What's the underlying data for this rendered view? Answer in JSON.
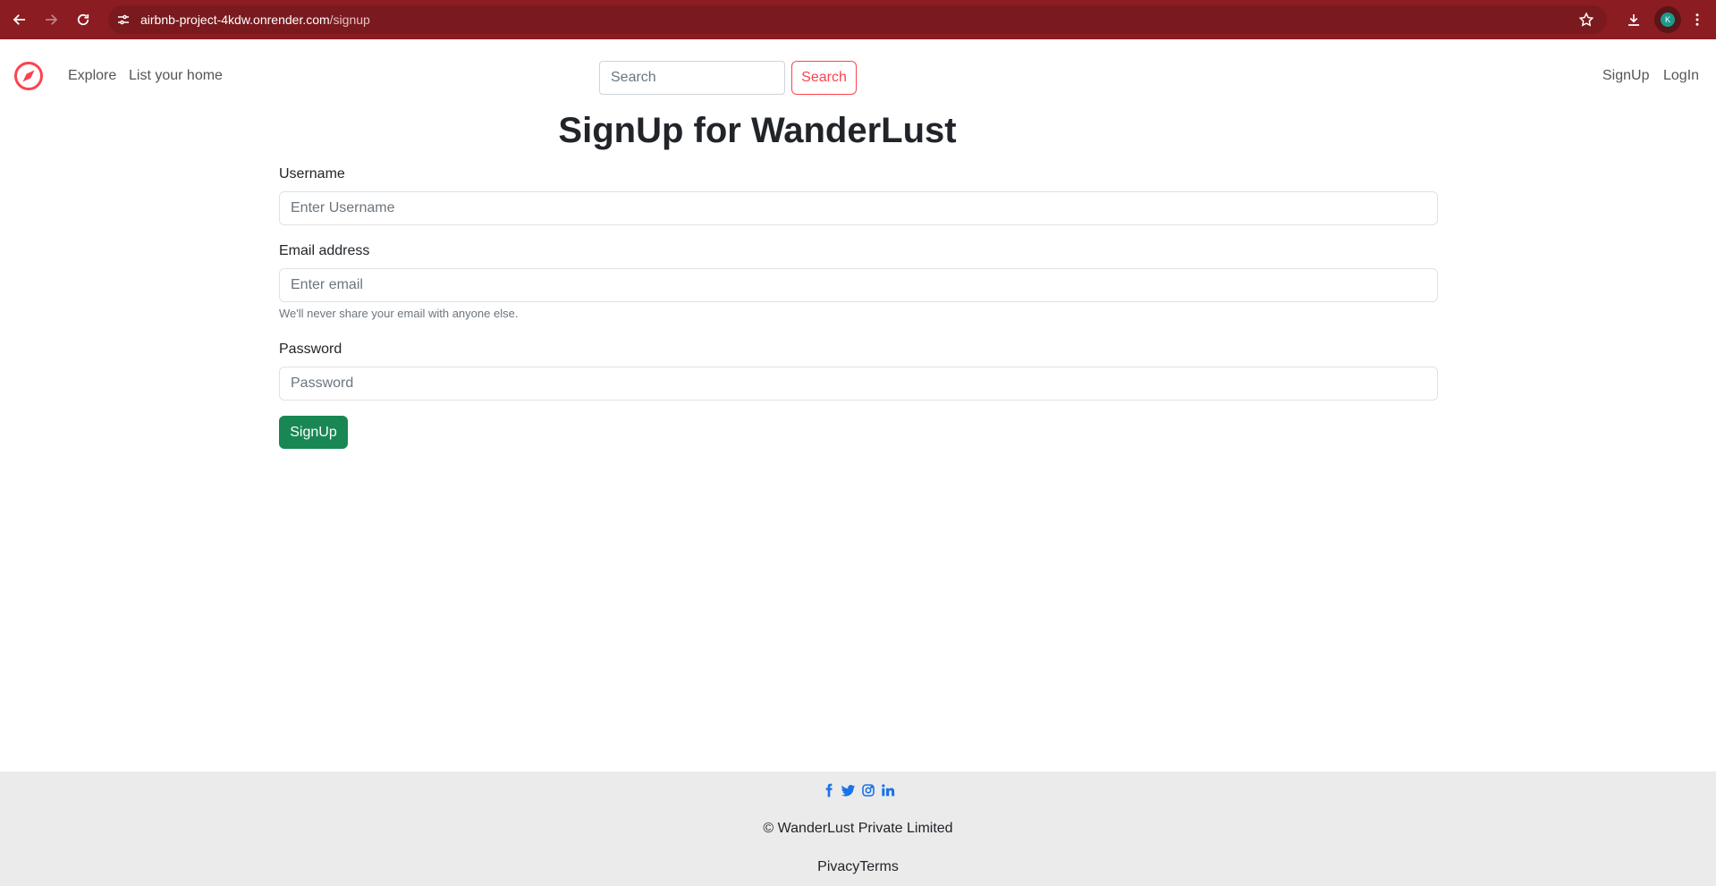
{
  "browser": {
    "url_host": "airbnb-project-4kdw.onrender.com",
    "url_path": "/signup",
    "profile_initial": "K"
  },
  "navbar": {
    "brand_icon": "compass-icon",
    "explore": "Explore",
    "list_home": "List your home",
    "search_placeholder": "Search",
    "search_button": "Search",
    "signup": "SignUp",
    "login": "LogIn"
  },
  "form": {
    "title": "SignUp for WanderLust",
    "username_label": "Username",
    "username_placeholder": "Enter Username",
    "email_label": "Email address",
    "email_placeholder": "Enter email",
    "email_help": "We'll never share your email with anyone else.",
    "password_label": "Password",
    "password_placeholder": "Password",
    "submit": "SignUp"
  },
  "footer": {
    "socials": [
      "facebook-icon",
      "twitter-icon",
      "instagram-icon",
      "linkedin-icon"
    ],
    "copyright": "© WanderLust Private Limited",
    "privacy": "Pivacy",
    "terms": "Terms"
  },
  "colors": {
    "chrome": "#8b1c22",
    "brand": "#fe424d",
    "submit": "#198754",
    "footer_bg": "#ebebeb",
    "social": "#1a73e8"
  }
}
